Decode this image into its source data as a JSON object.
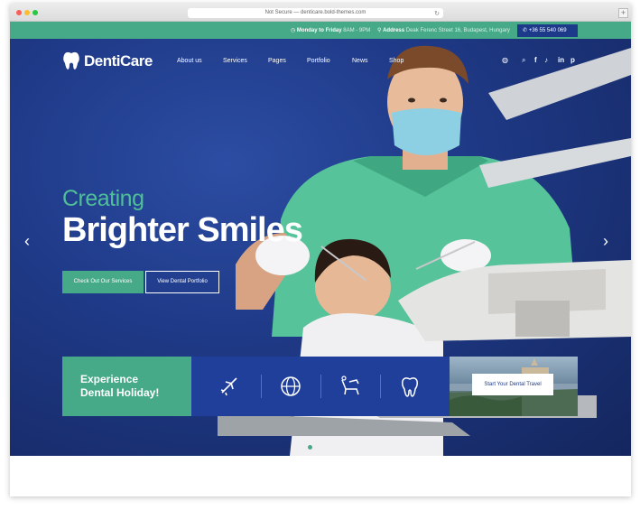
{
  "browser": {
    "url_text": "Not Secure — denticare.bold-themes.com",
    "reload_icon": "reload-icon",
    "new_tab_label": "+"
  },
  "topbar": {
    "hours_label": "Monday to Friday",
    "hours_value": "8AM - 9PM",
    "address_label": "Address",
    "address_value": "Deak Ferenc Street 16, Budapest, Hungary",
    "phone": "+36 55 540 069"
  },
  "header": {
    "logo_text": "DentiCare",
    "nav": [
      "About us",
      "Services",
      "Pages",
      "Portfolio",
      "News",
      "Shop"
    ],
    "cart_count": "0"
  },
  "hero": {
    "line1": "Creating",
    "line2": "Brighter Smiles",
    "primary_button": "Check Out Our Services",
    "secondary_button": "View Dental Portfolio",
    "prev_arrow": "‹",
    "next_arrow": "›"
  },
  "promo": {
    "title_line1": "Experience",
    "title_line2": "Dental Holiday!",
    "icons": [
      "airplane-icon",
      "globe-icon",
      "dental-chair-icon",
      "tooth-icon"
    ],
    "button": "Start Your Dental Travel"
  },
  "colors": {
    "green": "#46a987",
    "navy": "#1d3a8a",
    "hero_blue": "#1f3a88"
  }
}
